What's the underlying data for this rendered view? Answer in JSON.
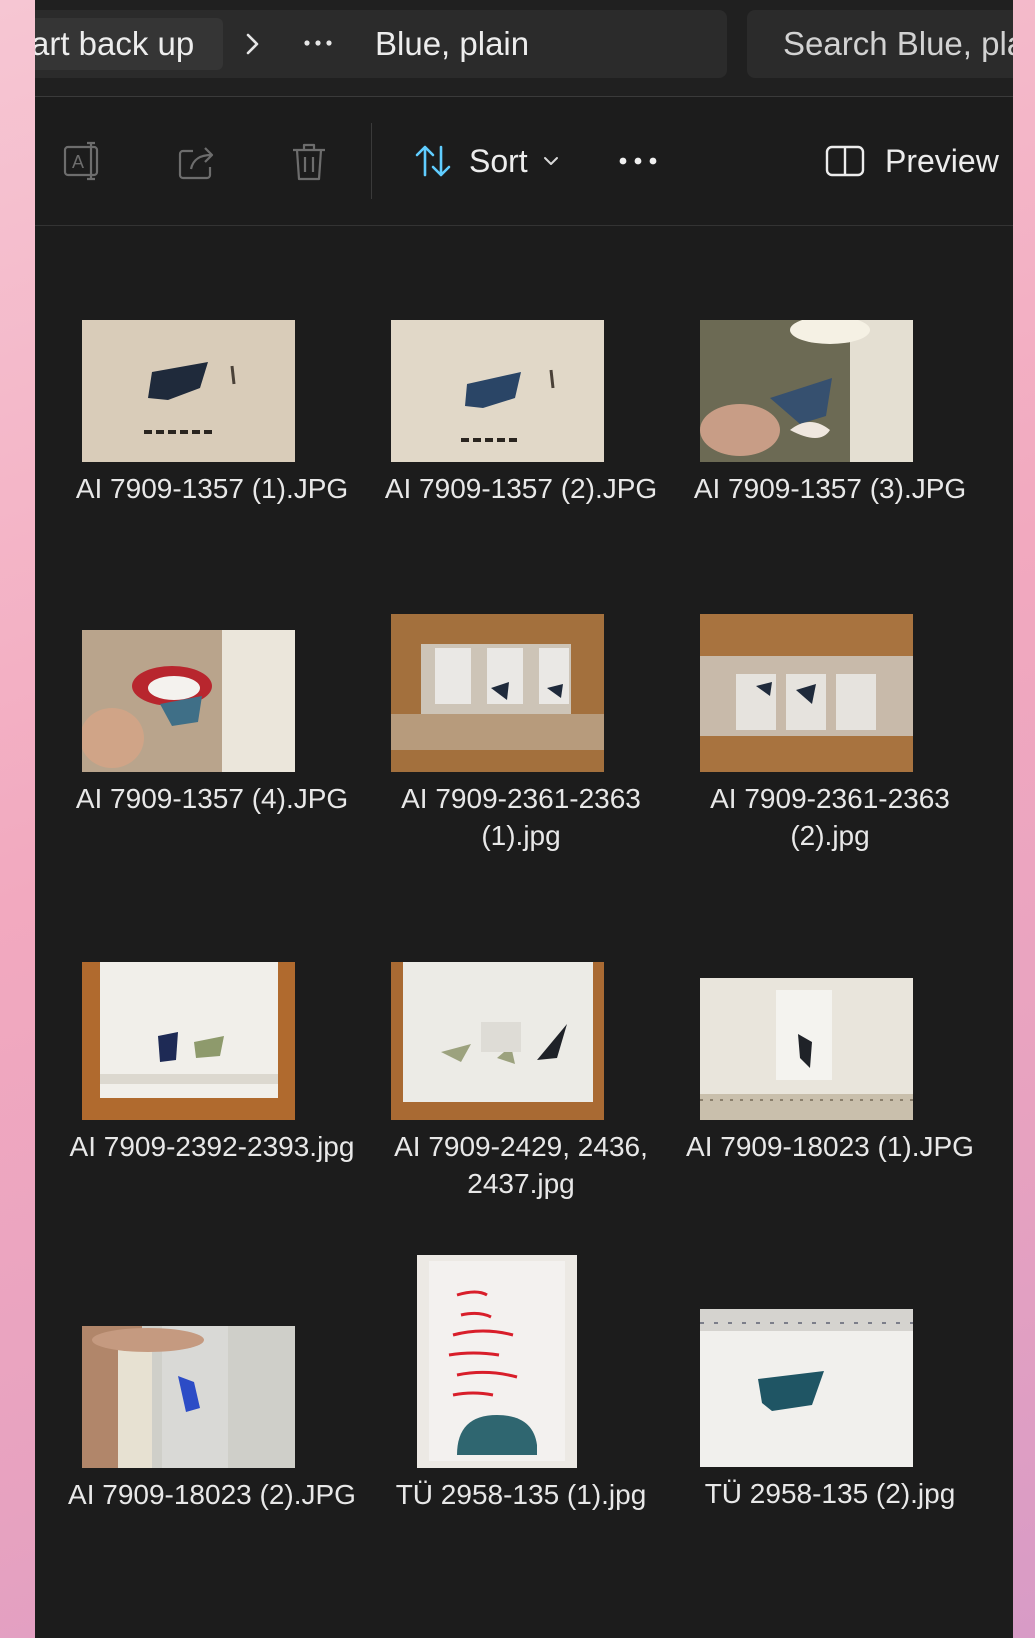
{
  "breadcrumb": {
    "first_segment": "art back up",
    "separator": ">",
    "overflow": "···",
    "current": "Blue, plain"
  },
  "search": {
    "placeholder": "Search Blue, plain"
  },
  "toolbar": {
    "sort_label": "Sort",
    "preview_label": "Preview"
  },
  "files": [
    {
      "name": "AI 7909-1357 (1).JPG"
    },
    {
      "name": "AI 7909-1357 (2).JPG"
    },
    {
      "name": "AI 7909-1357 (3).JPG"
    },
    {
      "name": "AI 7909-1357 (4).JPG"
    },
    {
      "name": "AI 7909-2361-2363 (1).jpg"
    },
    {
      "name": "AI 7909-2361-2363 (2).jpg"
    },
    {
      "name": "AI 7909-2392-2393.jpg"
    },
    {
      "name": "AI 7909-2429, 2436, 2437.jpg"
    },
    {
      "name": "AI 7909-18023 (1).JPG"
    },
    {
      "name": "AI 7909-18023 (2).JPG"
    },
    {
      "name": "TÜ 2958-135 (1).jpg"
    },
    {
      "name": "TÜ 2958-135 (2).jpg"
    }
  ],
  "icons": {
    "rename": "rename-icon",
    "share": "share-icon",
    "delete": "trash-icon",
    "sort": "sort-arrows-icon",
    "sort_chevron": "chevron-down-icon",
    "more": "more-dots-icon",
    "preview": "preview-pane-icon"
  },
  "colors": {
    "window_bg": "#1c1c1c",
    "accent": "#60cdff"
  }
}
